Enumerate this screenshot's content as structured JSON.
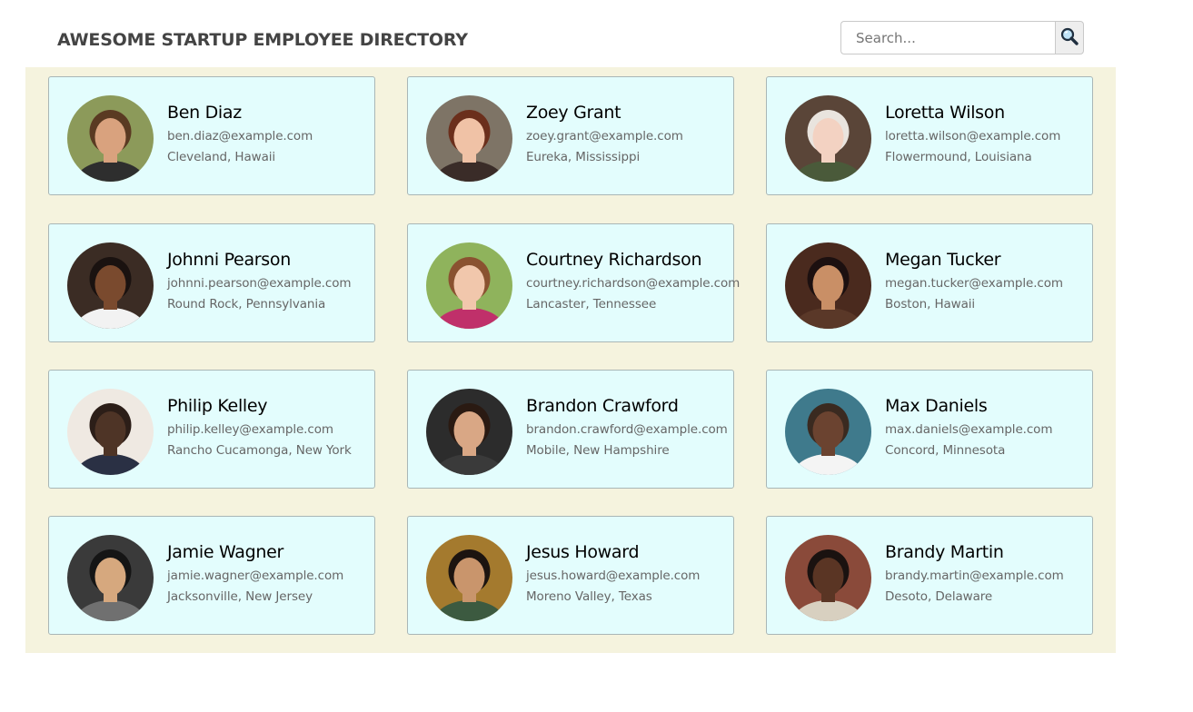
{
  "header": {
    "title": "AWESOME STARTUP EMPLOYEE DIRECTORY",
    "search_placeholder": "Search...",
    "search_icon": "magnifier-icon"
  },
  "colors": {
    "gallery_bg": "#f5f3de",
    "card_bg": "#e3fdfd",
    "card_border": "#a9b6b6"
  },
  "employees": [
    {
      "name": "Ben Diaz",
      "email": "ben.diaz@example.com",
      "location": "Cleveland, Hawaii"
    },
    {
      "name": "Zoey Grant",
      "email": "zoey.grant@example.com",
      "location": "Eureka, Mississippi"
    },
    {
      "name": "Loretta Wilson",
      "email": "loretta.wilson@example.com",
      "location": "Flowermound, Louisiana"
    },
    {
      "name": "Johnni Pearson",
      "email": "johnni.pearson@example.com",
      "location": "Round Rock, Pennsylvania"
    },
    {
      "name": "Courtney Richardson",
      "email": "courtney.richardson@example.com",
      "location": "Lancaster, Tennessee"
    },
    {
      "name": "Megan Tucker",
      "email": "megan.tucker@example.com",
      "location": "Boston, Hawaii"
    },
    {
      "name": "Philip Kelley",
      "email": "philip.kelley@example.com",
      "location": "Rancho Cucamonga, New York"
    },
    {
      "name": "Brandon Crawford",
      "email": "brandon.crawford@example.com",
      "location": "Mobile, New Hampshire"
    },
    {
      "name": "Max Daniels",
      "email": "max.daniels@example.com",
      "location": "Concord, Minnesota"
    },
    {
      "name": "Jamie Wagner",
      "email": "jamie.wagner@example.com",
      "location": "Jacksonville, New Jersey"
    },
    {
      "name": "Jesus Howard",
      "email": "jesus.howard@example.com",
      "location": "Moreno Valley, Texas"
    },
    {
      "name": "Brandy Martin",
      "email": "brandy.martin@example.com",
      "location": "Desoto, Delaware"
    }
  ]
}
